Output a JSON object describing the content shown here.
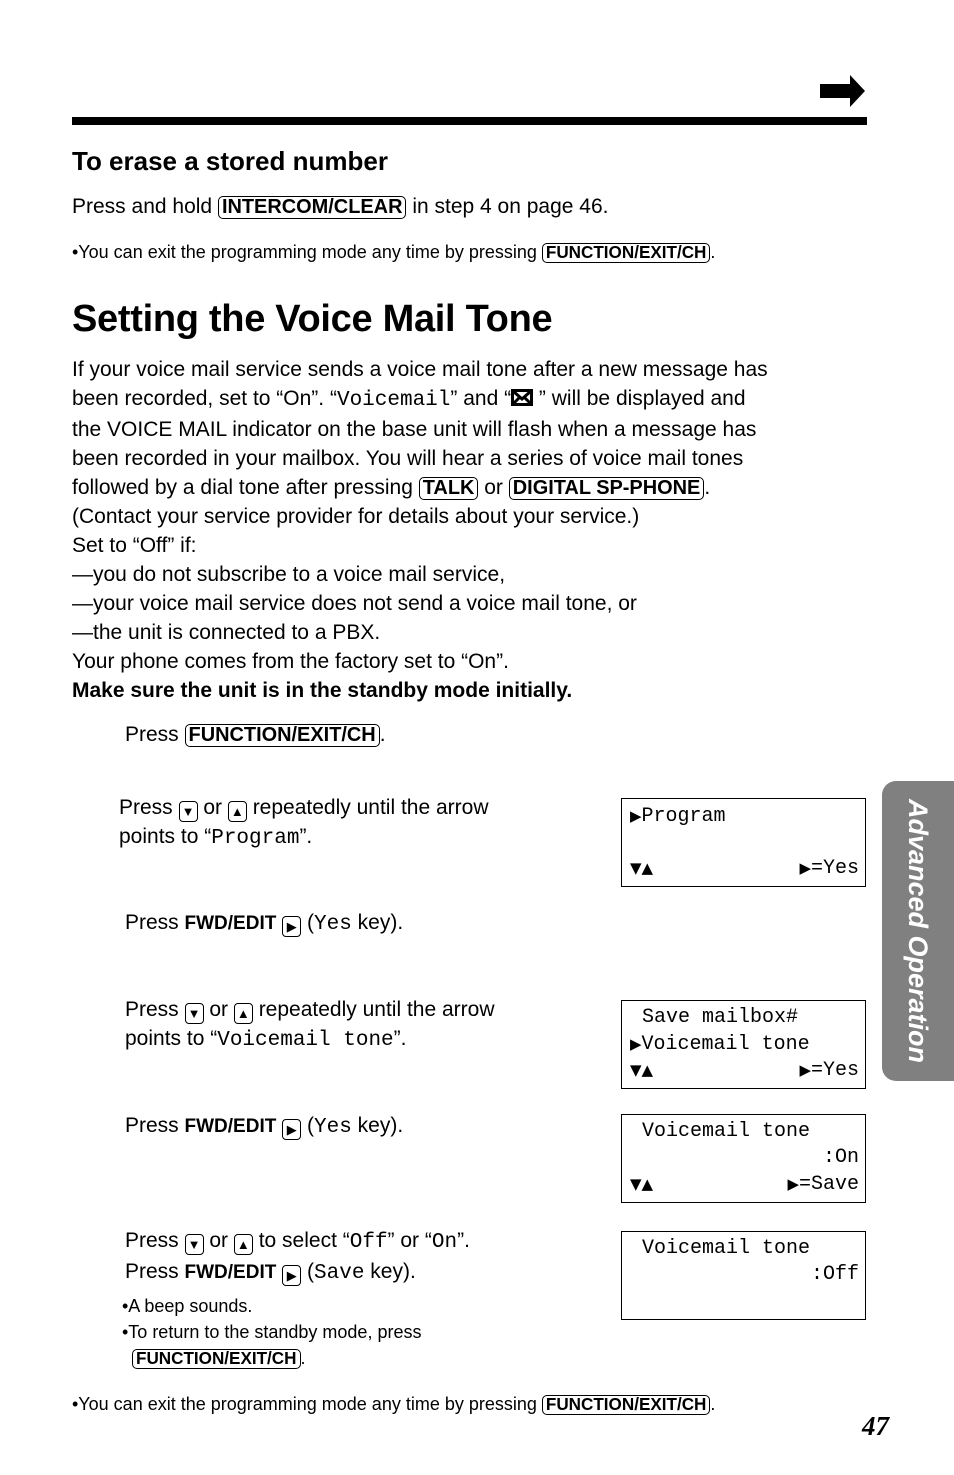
{
  "header": {
    "continue_icon": "right-arrow-icon"
  },
  "erase_section": {
    "heading": "To erase a stored number",
    "text_before": "Press and hold ",
    "key": "INTERCOM/CLEAR",
    "text_after": " in step 4 on page 46.",
    "note_before": "•You can exit the programming mode any time by pressing ",
    "note_key": "FUNCTION/EXIT/CH",
    "note_after": "."
  },
  "main_section": {
    "title": "Setting the Voice Mail Tone",
    "para": {
      "l1": "If your voice mail service sends a voice mail tone after a new message has",
      "l2a": "been recorded, set to “On”. “",
      "l2_mono": "Voicemail",
      "l2b": "” and “",
      "l2_icon": "envelope-icon",
      "l2c": " ” will be displayed and",
      "l3": "the VOICE MAIL indicator on the base unit will flash when a message has",
      "l4": "been recorded in your mailbox. You will hear a series of voice mail tones",
      "l5a": "followed by a dial tone after pressing ",
      "l5_key1": "TALK",
      "l5b": " or ",
      "l5_key2": "DIGITAL SP-PHONE",
      "l5c": ".",
      "l6": "(Contact your service provider for details about your service.)",
      "l7": "Set to “Off” if:",
      "l8": "—you do not subscribe to a voice mail service,",
      "l9": "—your voice mail service does not send a voice mail tone, or",
      "l10": "—the unit is connected to a PBX.",
      "l11": "Your phone comes from the factory set to “On”.",
      "l12": "Make sure the unit is in the standby mode initially."
    }
  },
  "steps": [
    {
      "press": "Press ",
      "key": "FUNCTION/EXIT/CH",
      "after": "."
    },
    {
      "press": "Press ",
      "down": "▼",
      "or": " or ",
      "up": "▲",
      "l1_after": " repeatedly until the arrow",
      "l2_before": "points to “",
      "l2_mono": "Program",
      "l2_after": "”."
    },
    {
      "press": "Press ",
      "bold": "FWD/EDIT",
      "right": "▶",
      "paren_open": " (",
      "mono": "Yes",
      "after": " key)."
    },
    {
      "press": "Press ",
      "down": "▼",
      "or": " or ",
      "up": "▲",
      "l1_after": " repeatedly until the arrow",
      "l2_before": "points to “",
      "l2_mono": "Voicemail tone",
      "l2_after": "”."
    },
    {
      "press": "Press ",
      "bold": "FWD/EDIT",
      "right": "▶",
      "paren_open": " (",
      "mono": "Yes",
      "after": " key)."
    },
    {
      "press": "Press ",
      "down": "▼",
      "or": " or ",
      "up": "▲",
      "l1_mid": " to select “",
      "mono1": "Off",
      "l1_mid2": "” or “",
      "mono2": "On",
      "l1_end": "”.",
      "l2_press": "Press ",
      "l2_bold": "FWD/EDIT",
      "right": "▶",
      "paren_open": " (",
      "l2_mono": "Save",
      "l2_after": " key).",
      "bullet1": "•A beep sounds.",
      "bullet2": "•To return to the standby mode, press",
      "bullet2_key": "FUNCTION/EXIT/CH",
      "bullet2_after": "."
    }
  ],
  "displays": [
    {
      "line1_arrow": "▶",
      "line1": "Program",
      "line2": "",
      "nav": "▼▲",
      "action_arrow": "▶",
      "action": "=Yes"
    },
    {
      "line1": " Save mailbox#",
      "line2_arrow": "▶",
      "line2": "Voicemail tone",
      "nav": "▼▲",
      "action_arrow": "▶",
      "action": "=Yes"
    },
    {
      "line1": " Voicemail tone",
      "line2": ":On",
      "nav": "▼▲",
      "action_arrow": "▶",
      "action": "=Save"
    },
    {
      "line1": " Voicemail tone",
      "line2": ":Off"
    }
  ],
  "footer": {
    "note_before": "•You can exit the programming mode any time by pressing ",
    "note_key": "FUNCTION/EXIT/CH",
    "note_after": ".",
    "page_number": "47"
  },
  "side_tab": {
    "label": "Advanced Operation",
    "color": "#808080"
  }
}
